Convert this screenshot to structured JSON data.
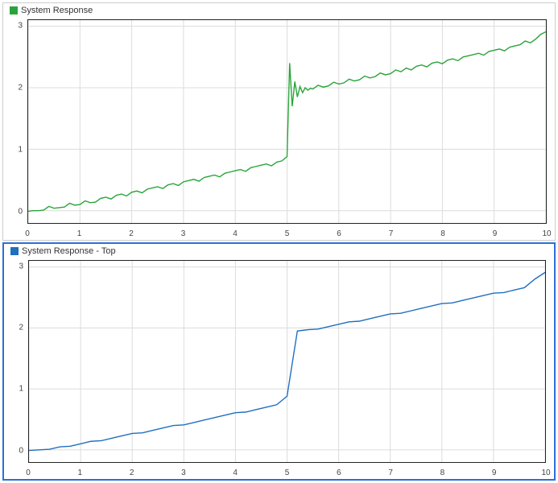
{
  "chart_data": [
    {
      "id": "top",
      "type": "line",
      "legend": "System Response",
      "color": "#2aa43a",
      "xlim": [
        0,
        10
      ],
      "ylim": [
        -0.2,
        3.1
      ],
      "xticks": [
        0,
        1,
        2,
        3,
        4,
        5,
        6,
        7,
        8,
        9,
        10
      ],
      "yticks": [
        0,
        1,
        2,
        3
      ],
      "x": [
        0.0,
        0.1,
        0.2,
        0.3,
        0.4,
        0.5,
        0.6,
        0.7,
        0.8,
        0.9,
        1.0,
        1.1,
        1.2,
        1.3,
        1.4,
        1.5,
        1.6,
        1.7,
        1.8,
        1.9,
        2.0,
        2.1,
        2.2,
        2.3,
        2.4,
        2.5,
        2.6,
        2.7,
        2.8,
        2.9,
        3.0,
        3.1,
        3.2,
        3.3,
        3.4,
        3.5,
        3.6,
        3.7,
        3.8,
        3.9,
        4.0,
        4.1,
        4.2,
        4.3,
        4.4,
        4.5,
        4.6,
        4.7,
        4.8,
        4.9,
        5.0,
        5.05,
        5.1,
        5.15,
        5.2,
        5.25,
        5.3,
        5.35,
        5.4,
        5.45,
        5.5,
        5.6,
        5.7,
        5.8,
        5.9,
        6.0,
        6.1,
        6.2,
        6.3,
        6.4,
        6.5,
        6.6,
        6.7,
        6.8,
        6.9,
        7.0,
        7.1,
        7.2,
        7.3,
        7.4,
        7.5,
        7.6,
        7.7,
        7.8,
        7.9,
        8.0,
        8.1,
        8.2,
        8.3,
        8.4,
        8.5,
        8.6,
        8.7,
        8.8,
        8.9,
        9.0,
        9.1,
        9.2,
        9.3,
        9.4,
        9.5,
        9.6,
        9.7,
        9.8,
        9.9,
        10.0
      ],
      "y": [
        -0.01,
        0.0,
        0.0,
        0.01,
        0.07,
        0.04,
        0.05,
        0.06,
        0.12,
        0.09,
        0.1,
        0.16,
        0.13,
        0.14,
        0.2,
        0.22,
        0.19,
        0.25,
        0.27,
        0.24,
        0.3,
        0.32,
        0.29,
        0.35,
        0.37,
        0.39,
        0.36,
        0.42,
        0.44,
        0.41,
        0.47,
        0.49,
        0.51,
        0.48,
        0.54,
        0.56,
        0.58,
        0.55,
        0.61,
        0.63,
        0.65,
        0.67,
        0.64,
        0.7,
        0.72,
        0.74,
        0.76,
        0.73,
        0.79,
        0.81,
        0.88,
        2.4,
        1.7,
        2.1,
        1.85,
        2.02,
        1.92,
        2.0,
        1.96,
        1.99,
        1.98,
        2.04,
        2.01,
        2.03,
        2.09,
        2.06,
        2.08,
        2.14,
        2.11,
        2.13,
        2.19,
        2.16,
        2.18,
        2.24,
        2.21,
        2.23,
        2.29,
        2.26,
        2.32,
        2.29,
        2.35,
        2.37,
        2.34,
        2.4,
        2.42,
        2.39,
        2.45,
        2.47,
        2.44,
        2.5,
        2.52,
        2.54,
        2.56,
        2.53,
        2.59,
        2.61,
        2.63,
        2.6,
        2.66,
        2.68,
        2.7,
        2.76,
        2.73,
        2.79,
        2.87,
        2.91
      ]
    },
    {
      "id": "bottom",
      "type": "line",
      "legend": "System Response - Top",
      "color": "#1f6fbf",
      "xlim": [
        0,
        10
      ],
      "ylim": [
        -0.2,
        3.1
      ],
      "xticks": [
        0,
        1,
        2,
        3,
        4,
        5,
        6,
        7,
        8,
        9,
        10
      ],
      "yticks": [
        0,
        1,
        2,
        3
      ],
      "x": [
        0.0,
        0.2,
        0.4,
        0.6,
        0.8,
        1.0,
        1.2,
        1.4,
        1.6,
        1.8,
        2.0,
        2.2,
        2.4,
        2.6,
        2.8,
        3.0,
        3.2,
        3.4,
        3.6,
        3.8,
        4.0,
        4.2,
        4.4,
        4.6,
        4.8,
        5.0,
        5.2,
        5.4,
        5.6,
        5.8,
        6.0,
        6.2,
        6.4,
        6.6,
        6.8,
        7.0,
        7.2,
        7.4,
        7.6,
        7.8,
        8.0,
        8.2,
        8.4,
        8.6,
        8.8,
        9.0,
        9.2,
        9.4,
        9.6,
        9.8,
        10.0
      ],
      "y": [
        -0.01,
        0.0,
        0.01,
        0.05,
        0.06,
        0.1,
        0.14,
        0.15,
        0.19,
        0.23,
        0.27,
        0.28,
        0.32,
        0.36,
        0.4,
        0.41,
        0.45,
        0.49,
        0.53,
        0.57,
        0.61,
        0.62,
        0.66,
        0.7,
        0.74,
        0.88,
        1.95,
        1.97,
        1.98,
        2.02,
        2.06,
        2.1,
        2.11,
        2.15,
        2.19,
        2.23,
        2.24,
        2.28,
        2.32,
        2.36,
        2.4,
        2.41,
        2.45,
        2.49,
        2.53,
        2.57,
        2.58,
        2.62,
        2.66,
        2.8,
        2.91
      ]
    }
  ],
  "panels": {
    "top_selected": false,
    "bottom_selected": true
  }
}
